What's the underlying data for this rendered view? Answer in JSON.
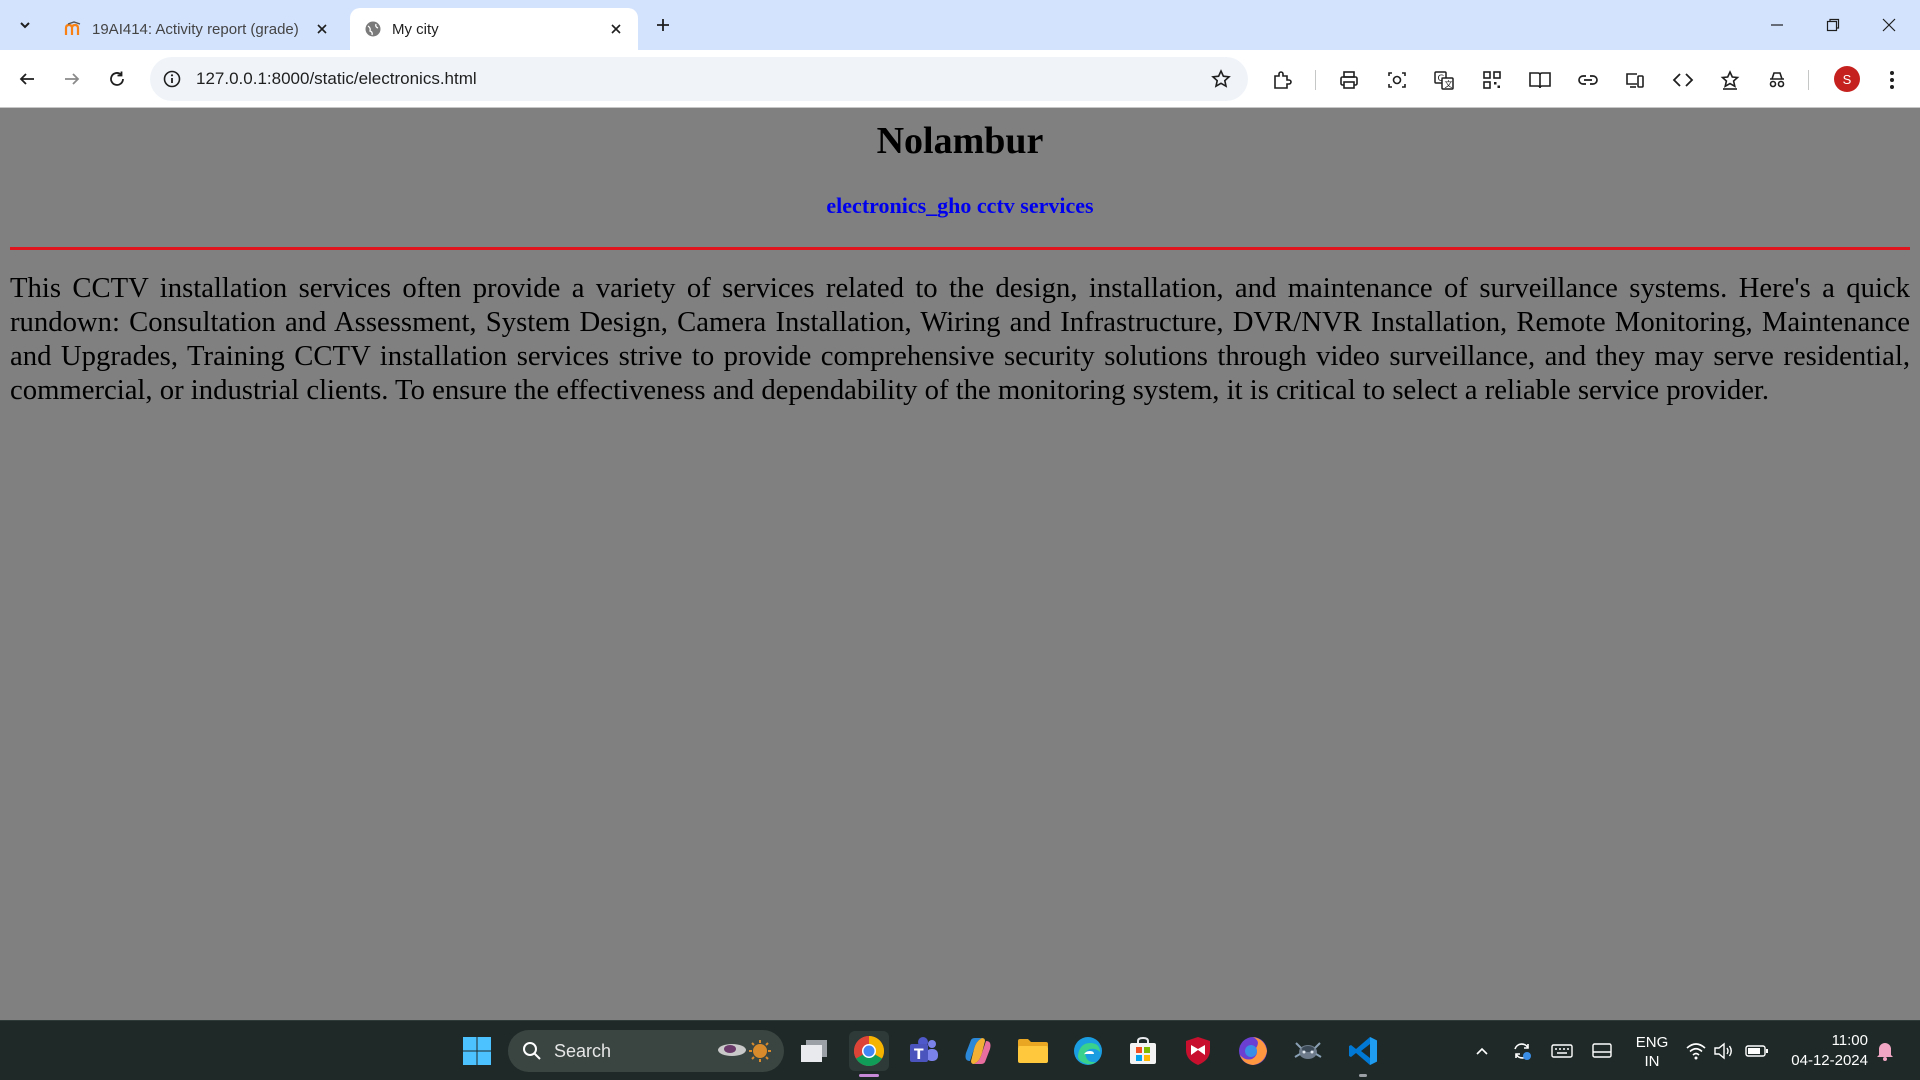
{
  "browser": {
    "tabs": [
      {
        "title": "19AI414: Activity report (grade)"
      },
      {
        "title": "My city"
      }
    ],
    "address": "127.0.0.1:8000/static/electronics.html",
    "profile_initial": "S"
  },
  "page": {
    "heading": "Nolambur",
    "subheading": "electronics_gho cctv services",
    "paragraph": "This CCTV installation services often provide a variety of services related to the design, installation, and maintenance of surveillance systems. Here's a quick rundown: Consultation and Assessment, System Design, Camera Installation, Wiring and Infrastructure, DVR/NVR Installation, Remote Monitoring, Maintenance and Upgrades, Training CCTV installation services strive to provide comprehensive security solutions through video surveillance, and they may serve residential, commercial, or industrial clients. To ensure the effectiveness and dependability of the monitoring system, it is critical to select a reliable service provider.",
    "colors": {
      "background": "#808080",
      "heading": "#000000",
      "subheading": "#0000ee",
      "rule": "#e0141c"
    }
  },
  "taskbar": {
    "search_label": "Search",
    "lang_line1": "ENG",
    "lang_line2": "IN",
    "time": "11:00",
    "date": "04-12-2024"
  }
}
